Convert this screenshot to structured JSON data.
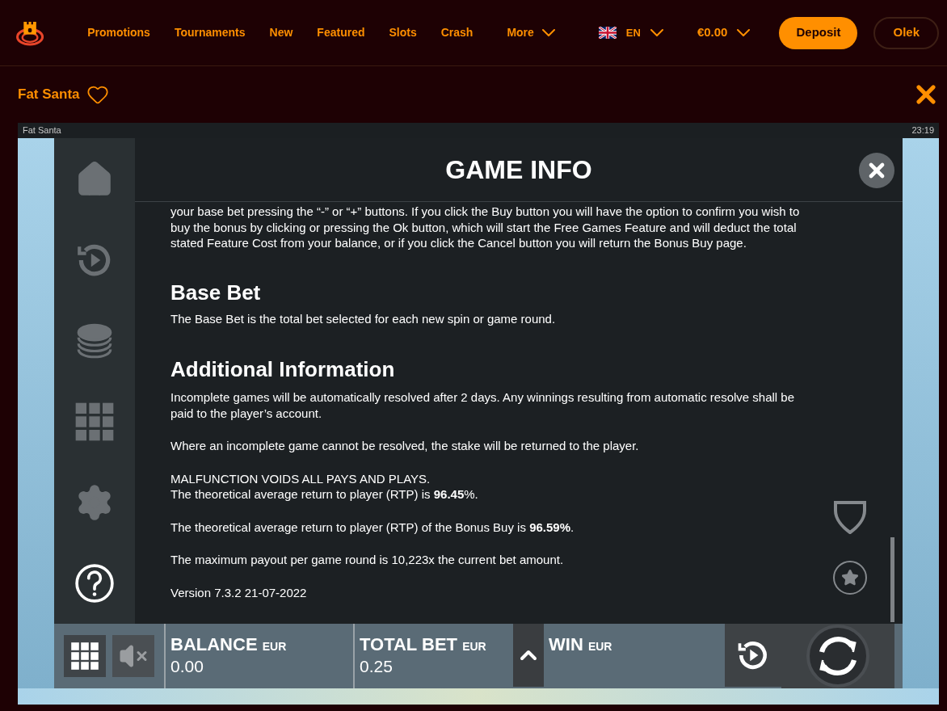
{
  "header": {
    "nav": [
      {
        "label": "Promotions",
        "dropdown": false
      },
      {
        "label": "Tournaments",
        "dropdown": false
      },
      {
        "label": "New",
        "dropdown": false
      },
      {
        "label": "Featured",
        "dropdown": false
      },
      {
        "label": "Slots",
        "dropdown": false
      },
      {
        "label": "Crash",
        "dropdown": false
      },
      {
        "label": "More",
        "dropdown": true
      }
    ],
    "language": "EN",
    "balance": "€0.00",
    "deposit_button": "Deposit",
    "user_button": "Olek"
  },
  "game_header": {
    "title": "Fat Santa",
    "favorite": false
  },
  "game": {
    "title": "Fat Santa",
    "clock": "23:19",
    "sidebar": [
      {
        "kind": "home",
        "selected": false
      },
      {
        "kind": "autoplay",
        "selected": false
      },
      {
        "kind": "coins",
        "selected": false
      },
      {
        "kind": "grid",
        "selected": false
      },
      {
        "kind": "settings",
        "selected": false
      },
      {
        "kind": "help",
        "selected": true
      }
    ],
    "info_title": "GAME INFO",
    "content": [
      {
        "kind": "paragraph",
        "text": "your base bet pressing the “-” or “+” buttons. If you click the Buy button you will have the option to confirm you wish to buy the bonus by clicking or pressing the Ok button, which will start the Free Games Feature and will deduct the total stated Feature Cost from your balance, or if you click the Cancel button you will return the Bonus Buy page."
      },
      {
        "kind": "heading",
        "text": "Base Bet"
      },
      {
        "kind": "paragraph",
        "text": "The Base Bet is the total bet selected for each new spin or game round."
      },
      {
        "kind": "heading",
        "text": "Additional Information"
      },
      {
        "kind": "paragraph",
        "text": "Incomplete games will be automatically resolved after 2 days. Any winnings resulting from automatic resolve shall be paid to the player’s account."
      },
      {
        "kind": "paragraph",
        "text": "Where an incomplete game cannot be resolved, the stake will be returned to the player."
      },
      {
        "kind": "paragraph",
        "text": "MALFUNCTION VOIDS ALL PAYS AND PLAYS."
      },
      {
        "kind": "line",
        "text": "The theoretical average return to player (RTP) is **96.45**%."
      },
      {
        "kind": "paragraph",
        "text": "The theoretical average return to player (RTP) of the Bonus Buy is **96.59%**."
      },
      {
        "kind": "paragraph",
        "text": "The maximum payout per game round is 10,223x the current bet amount."
      },
      {
        "kind": "paragraph",
        "text": "Version 7.3.2 21-07-2022"
      }
    ],
    "fields": [
      {
        "label": "BALANCE",
        "unit": "EUR",
        "value": "0.00"
      },
      {
        "label": "TOTAL BET",
        "unit": "EUR",
        "value": "0.25"
      },
      {
        "label": "WIN",
        "unit": "EUR"
      }
    ],
    "muted": true
  }
}
